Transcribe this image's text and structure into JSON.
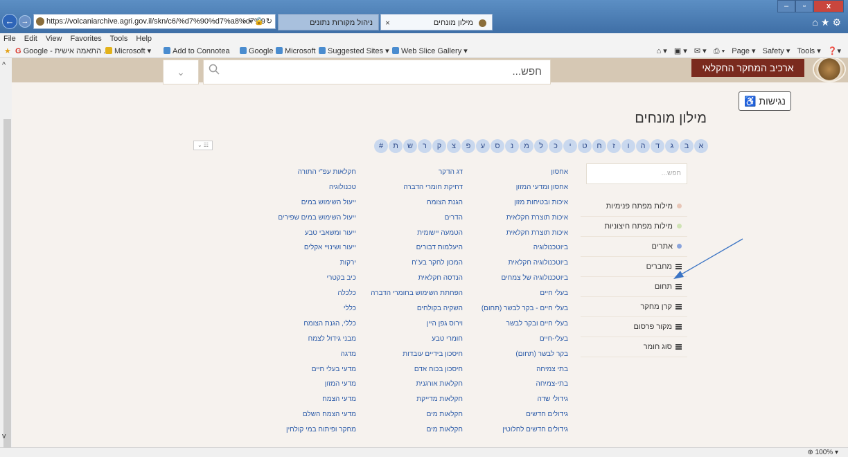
{
  "browser": {
    "url": "https://volcaniarchive.agri.gov.il/skn/c6/%d7%90%d7%a8%d7%9",
    "tabs": [
      {
        "label": "ניהול מקורות נתונים",
        "active": false
      },
      {
        "label": "מילון מונחים",
        "active": true
      }
    ],
    "window_controls": {
      "minimize": "–",
      "maximize": "▫",
      "close": "x"
    },
    "menu": [
      "File",
      "Edit",
      "View",
      "Favorites",
      "Tools",
      "Help"
    ],
    "favorites": [
      {
        "label": "Google - התאמה אישית ..."
      },
      {
        "label": "Microsoft ▾"
      },
      {
        "label": "Add to Connotea"
      },
      {
        "label": "Google"
      },
      {
        "label": "Microsoft"
      },
      {
        "label": "Suggested Sites ▾"
      },
      {
        "label": "Web Slice Gallery ▾"
      }
    ],
    "toolbar_right": [
      "Page ▾",
      "Safety ▾",
      "Tools ▾"
    ],
    "zoom": "100%"
  },
  "header": {
    "search_placeholder": "חפש...",
    "archive_label": "ארכיב המחקר החקלאי"
  },
  "accessibility_label": "נגישות",
  "page_title": "מילון מונחים",
  "letters": [
    "א",
    "ב",
    "ג",
    "ד",
    "ה",
    "ו",
    "ז",
    "ח",
    "ט",
    "י",
    "כ",
    "ל",
    "מ",
    "נ",
    "ס",
    "ע",
    "פ",
    "צ",
    "ק",
    "ר",
    "ש",
    "ת",
    "#"
  ],
  "sidebar": {
    "filter_placeholder": "חפש...",
    "items": [
      {
        "label": "מילות מפתח פנימיות",
        "marker": "dot",
        "color": "#e8c6b7"
      },
      {
        "label": "מילות מפתח חיצוניות",
        "marker": "dot",
        "color": "#cfe3b4"
      },
      {
        "label": "אתרים",
        "marker": "dot",
        "color": "#8aa4dc"
      },
      {
        "label": "מחברים",
        "marker": "menu"
      },
      {
        "label": "תחום",
        "marker": "menu"
      },
      {
        "label": "קרן מחקר",
        "marker": "menu"
      },
      {
        "label": "מקור פרסום",
        "marker": "menu"
      },
      {
        "label": "סוג חומר",
        "marker": "menu"
      }
    ]
  },
  "terms": {
    "col1": [
      "אחסון",
      "אחסון ומדעי המזון",
      "איכות ובטיחות מזון",
      "איכות תוצרת חקלאית",
      "איכות תוצרת חקלאית",
      "ביוטכנולוגיה",
      "ביוטכנולוגיה חקלאית",
      "ביוטכנולוגיה של צמחים",
      "בעלי חיים",
      "בעלי חיים - בקר לבשר (תחום)",
      "בעלי חיים ובקר לבשר",
      "בעלי-חיים",
      "בקר לבשר (תחום)",
      "בתי צמיחה",
      "בתי-צמיחה",
      "גידולי שדה",
      "גידולים חדשים",
      "גידולים חדשים לחלוטין"
    ],
    "col2": [
      "דג הדקר",
      "דחיקת חומרי הדברה",
      "הגנת הצומח",
      "הדרים",
      "הטמעה יישומית",
      "היעלמות דבורים",
      "המכון לחקר בע\"ח",
      "הנדסה חקלאית",
      "הפחתת השימוש בחומרי הדברה",
      "השקיה בקולחים",
      "וירוס גפן היין",
      "חומרי טבע",
      "חיסכון בידיים עובדות",
      "חיסכון בכוח אדם",
      "חקלאות אורגנית",
      "חקלאות מדייקת",
      "חקלאות מים",
      "חקלאות מים"
    ],
    "col3": [
      "חקלאות עפ\"י התורה",
      "טכנולוגיה",
      "ייעול השימוש במים",
      "ייעול השימוש במים שפירים",
      "ייעור ומשאבי טבע",
      "ייעור ושינויי אקלים",
      "ירקות",
      "כיב בקטרי",
      "כלכלה",
      "כללי",
      "כללי, הגנת הצומח",
      "מבני גידול לצמח",
      "מדגה",
      "מדעי בעלי חיים",
      "מדעי המזון",
      "מדעי הצמח",
      "מדעי הצמח השלם",
      "מחקר ופיתוח במי קולחין"
    ]
  },
  "colors": {
    "link": "#2a5aa8",
    "header_bg": "#d6c8b4",
    "page_bg": "#f6f2ee",
    "archive_button": "#7a2a1e",
    "annotation_arrow": "#3b74c4"
  }
}
